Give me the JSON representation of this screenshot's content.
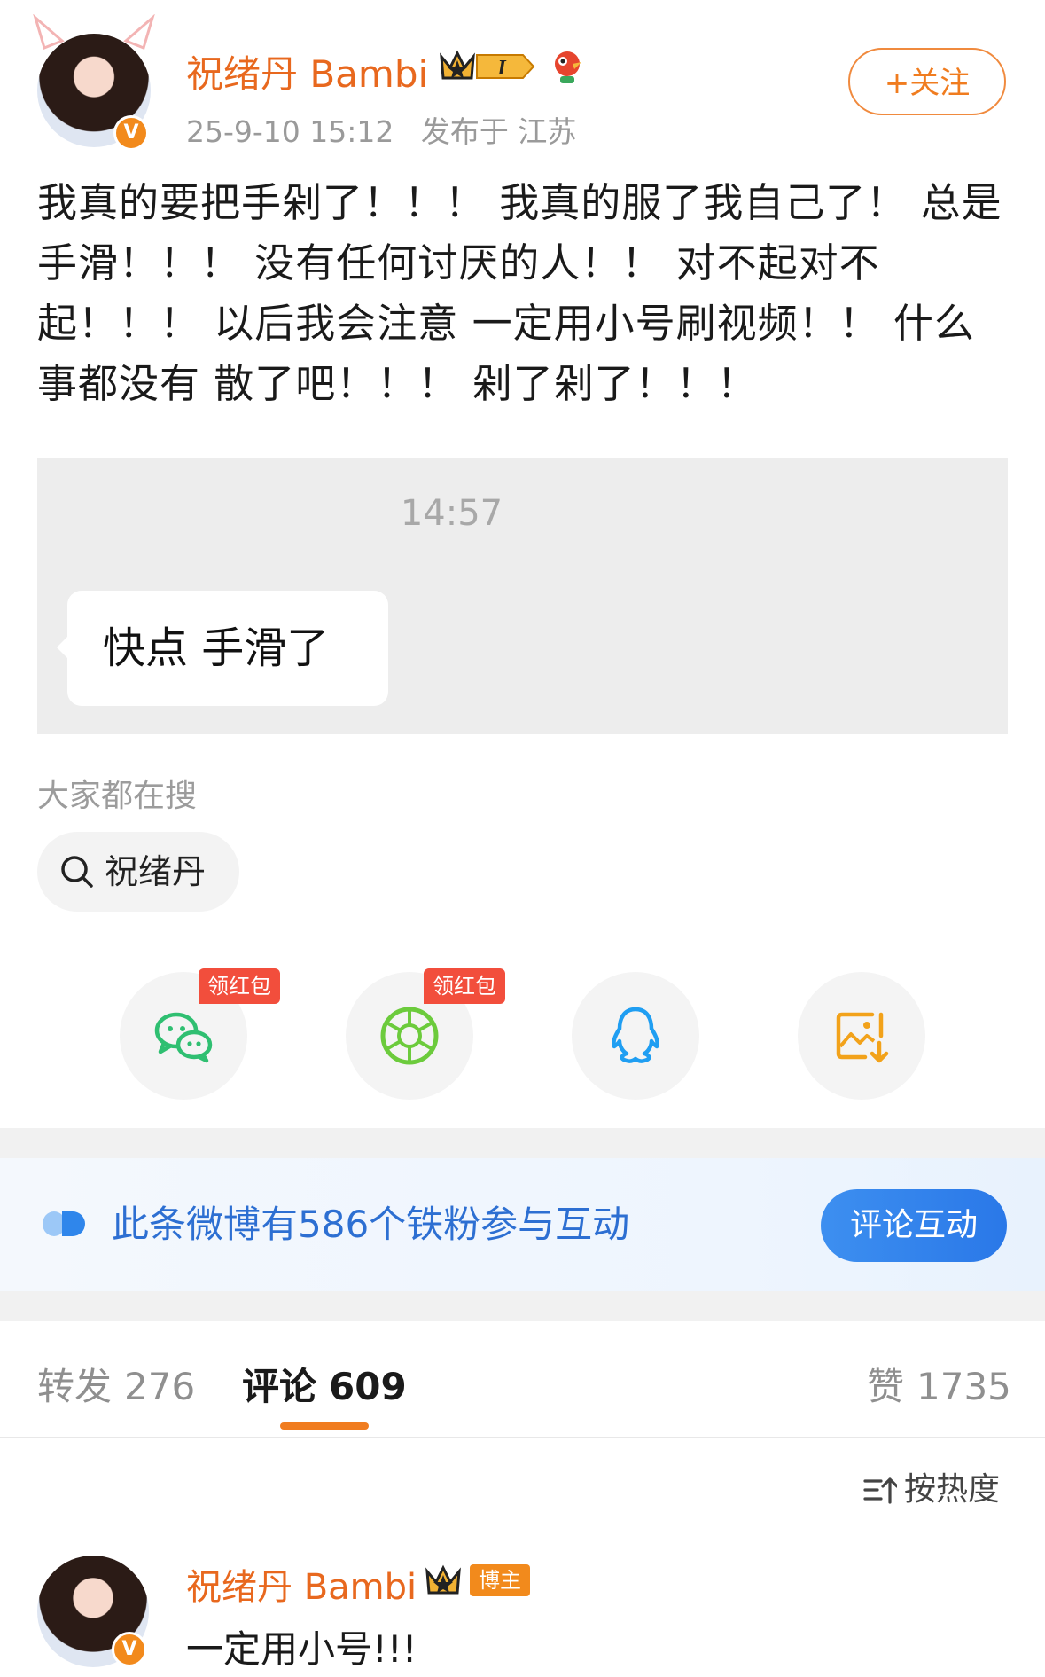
{
  "post": {
    "username": "祝绪丹 Bambi",
    "level_badge": "I",
    "time": "25-9-10 15:12",
    "location": "发布于 江苏",
    "follow_label": "+关注",
    "text": "我真的要把手剁了！！！ 我真的服了我自己了！ 总是手滑！！！ 没有任何讨厌的人！！ 对不起对不起！！！ 以后我会注意 一定用小号刷视频！！ 什么事都没有 散了吧！！！ 剁了剁了！！！",
    "image": {
      "time": "14:57",
      "bubble_text": "快点 手滑了"
    }
  },
  "search": {
    "title": "大家都在搜",
    "chip": "祝绪丹"
  },
  "share": {
    "red_packet_label": "领红包",
    "items": [
      "wechat-icon",
      "moments-icon",
      "qq-icon",
      "save-image-icon"
    ]
  },
  "fans_banner": {
    "text": "此条微博有586个铁粉参与互动",
    "button": "评论互动"
  },
  "tabs": {
    "repost_label": "转发",
    "repost_count": "276",
    "comment_label": "评论",
    "comment_count": "609",
    "like_label": "赞",
    "like_count": "1735"
  },
  "sort_label": "按热度",
  "comment": {
    "username": "祝绪丹 Bambi",
    "owner_badge": "博主",
    "text": "一定用小号!!!"
  },
  "colors": {
    "accent_orange": "#f07c1f",
    "username_orange": "#e8681e",
    "link_blue": "#2d6fd2",
    "red_packet": "#f24e3c"
  }
}
